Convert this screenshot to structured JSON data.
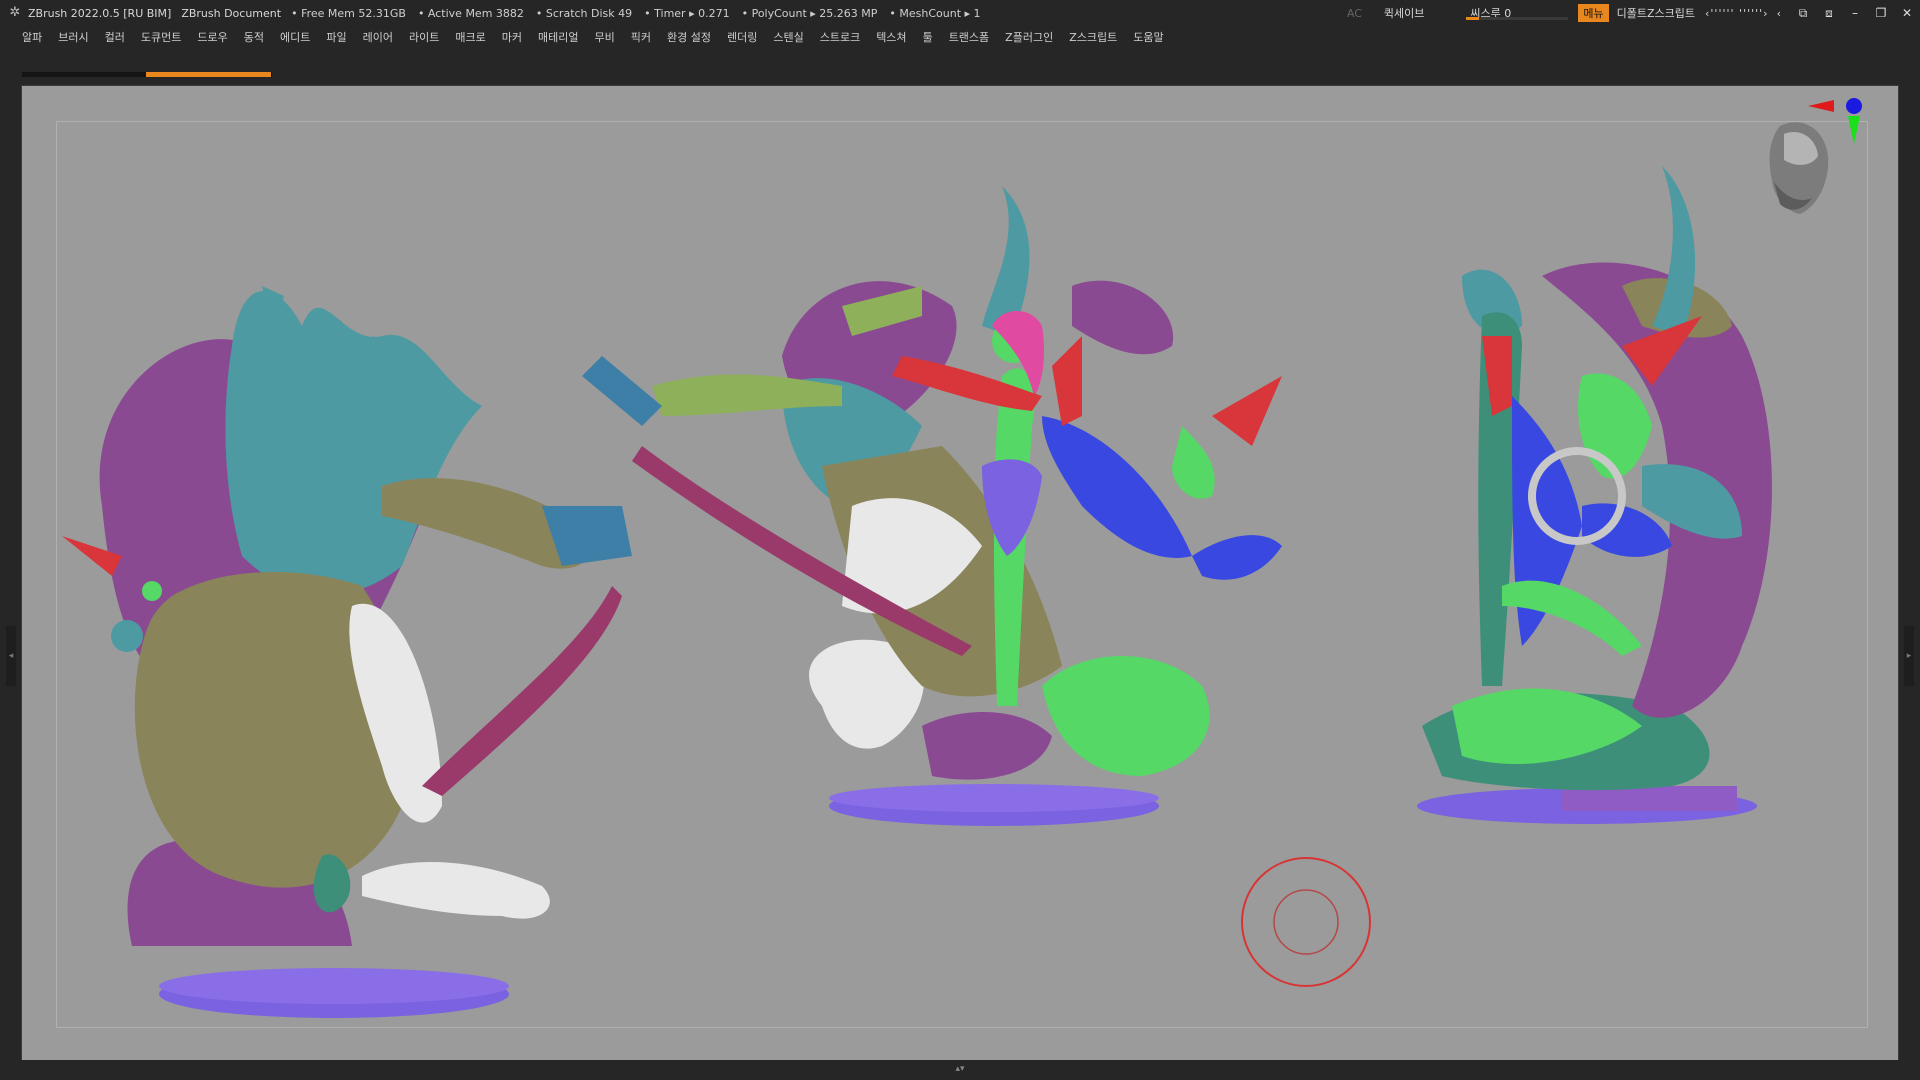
{
  "titlebar": {
    "app": "ZBrush 2022.0.5 [RU BIM]",
    "document": "ZBrush Document",
    "free_mem": "• Free Mem 52.31GB",
    "active_mem": "• Active Mem 3882",
    "scratch": "• Scratch Disk 49",
    "timer": "• Timer ▸ 0.271",
    "polycount": "• PolyCount ▸ 25.263 MP",
    "meshcount": "• MeshCount ▸ 1",
    "ac": "AC",
    "quicksave": "퀵세이브",
    "see_through_label": "씨스루 0",
    "see_through_value": 0.12,
    "menu_button": "메뉴",
    "default_zscript": "디폴트Z스크립트",
    "layout_glyphs_a": "‹'''''' ''''''›",
    "layout_glyphs_b": "‹"
  },
  "menubar": {
    "items": [
      "알파",
      "브러시",
      "컬러",
      "도큐먼트",
      "드로우",
      "동적",
      "에디트",
      "파일",
      "레이어",
      "라이트",
      "매크로",
      "마커",
      "매테리얼",
      "무비",
      "픽커",
      "환경 설정",
      "렌더링",
      "스텐실",
      "스트로크",
      "텍스쳐",
      "툴",
      "트랜스폼",
      "Z플러그인",
      "Z스크립트",
      "도움말"
    ]
  },
  "progress": {
    "value": 0.5
  },
  "colors": {
    "accent": "#e8871e",
    "canvas": "#9b9b9b",
    "ui_dark": "#262626",
    "teal": "#4e9aa2",
    "purple": "#8a4a92",
    "olive": "#8a845a",
    "green": "#55d865",
    "blue": "#3848e0",
    "red": "#d8363a",
    "white": "#e8e8e8",
    "pink": "#e04aa0",
    "base": "#7a62e0"
  },
  "icons": {
    "app": "zbrush-logo-icon",
    "gyro": "orientation-gyro-icon",
    "head": "navigation-head-icon",
    "ring": "transpose-ring-icon"
  }
}
